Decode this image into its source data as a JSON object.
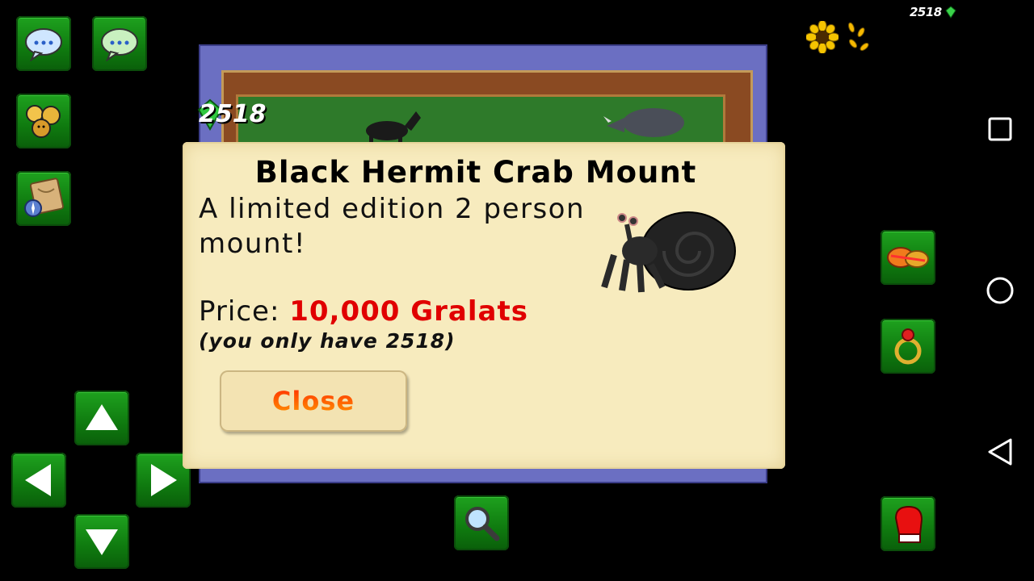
{
  "hud": {
    "gralats": "2518"
  },
  "map": {
    "gralat_counter": "2518"
  },
  "dialog": {
    "title": "Black Hermit Crab Mount",
    "description": "A limited edition 2 person mount!",
    "price_label": "Price:",
    "price_value": "10,000 Gralats",
    "have_text": "(you only have 2518)",
    "close_label": "Close"
  },
  "buttons_left": [
    {
      "icon": "chat-bubble-icon"
    },
    {
      "icon": "chat-bubble-green-icon"
    },
    {
      "icon": "players-icon"
    },
    {
      "icon": "map-compass-icon"
    }
  ],
  "dpad": [
    "arrow-up-icon",
    "arrow-left-icon",
    "arrow-right-icon",
    "arrow-down-icon"
  ],
  "buttons_right": [
    "bomb-item-icon",
    "ring-icon",
    "glove-icon"
  ],
  "colors": {
    "button_green": "#139313",
    "parchment": "#f7ebbe",
    "price_red": "#e00000"
  }
}
